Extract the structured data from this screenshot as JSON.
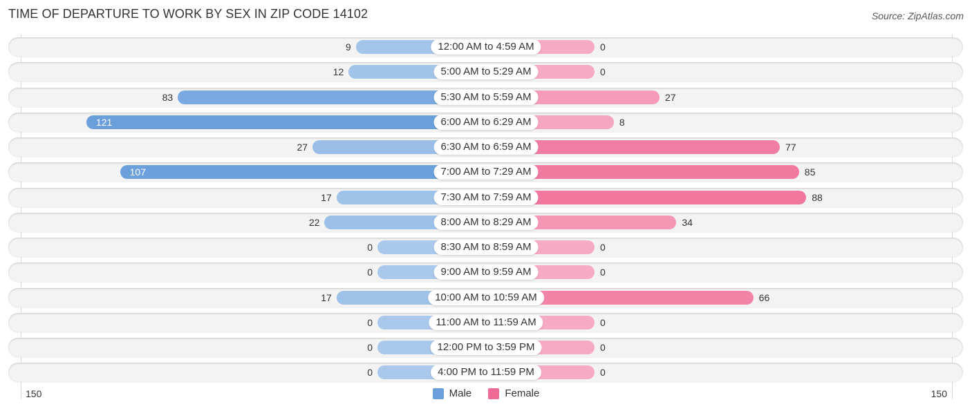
{
  "header": {
    "title": "TIME OF DEPARTURE TO WORK BY SEX IN ZIP CODE 14102",
    "source": "Source: ZipAtlas.com"
  },
  "chart_data": {
    "type": "bar",
    "orientation": "horizontal-diverging",
    "title": "TIME OF DEPARTURE TO WORK BY SEX IN ZIP CODE 14102",
    "categories": [
      "12:00 AM to 4:59 AM",
      "5:00 AM to 5:29 AM",
      "5:30 AM to 5:59 AM",
      "6:00 AM to 6:29 AM",
      "6:30 AM to 6:59 AM",
      "7:00 AM to 7:29 AM",
      "7:30 AM to 7:59 AM",
      "8:00 AM to 8:29 AM",
      "8:30 AM to 8:59 AM",
      "9:00 AM to 9:59 AM",
      "10:00 AM to 10:59 AM",
      "11:00 AM to 11:59 AM",
      "12:00 PM to 3:59 PM",
      "4:00 PM to 11:59 PM"
    ],
    "series": [
      {
        "name": "Male",
        "color": "#6a9fdc",
        "light_color": "#a9c8eb",
        "values": [
          9,
          12,
          83,
          121,
          27,
          107,
          17,
          22,
          0,
          0,
          17,
          0,
          0,
          0
        ]
      },
      {
        "name": "Female",
        "color": "#f06a96",
        "light_color": "#f7aac3",
        "values": [
          0,
          0,
          27,
          8,
          77,
          85,
          88,
          34,
          0,
          0,
          66,
          0,
          0,
          0
        ]
      }
    ],
    "xlim": [
      -150,
      150
    ],
    "tick_labels": {
      "left": "150",
      "right": "150"
    },
    "legend": {
      "placement": "bottom-center",
      "entries": [
        "Male",
        "Female"
      ]
    },
    "grid": false
  }
}
